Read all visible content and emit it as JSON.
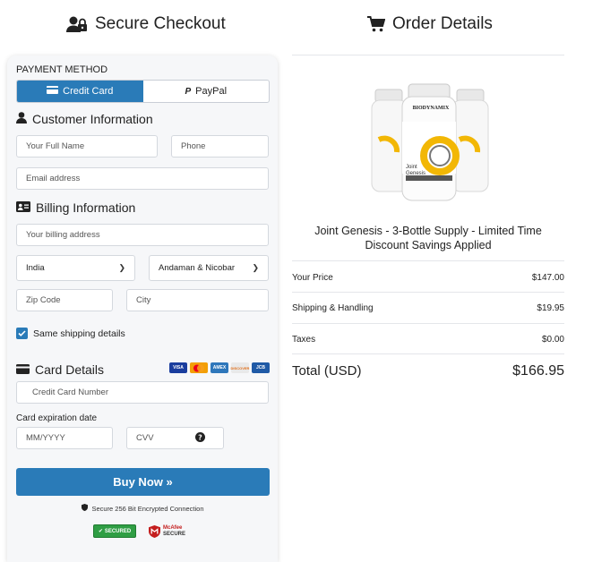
{
  "left": {
    "title": "Secure Checkout",
    "payment_method_label": "PAYMENT METHOD",
    "tabs": [
      {
        "label": "Credit Card",
        "active": true
      },
      {
        "label": "PayPal",
        "active": false
      }
    ],
    "customer_section": "Customer Information",
    "full_name_placeholder": "Your Full Name",
    "phone_placeholder": "Phone",
    "email_placeholder": "Email address",
    "billing_section": "Billing Information",
    "billing_address_placeholder": "Your billing address",
    "country_value": "India",
    "state_value": "Andaman & Nicobar",
    "zip_placeholder": "Zip Code",
    "city_placeholder": "City",
    "same_shipping_label": "Same shipping details",
    "same_shipping_checked": true,
    "card_section": "Card Details",
    "card_brands": [
      "VISA",
      "MC",
      "AMEX",
      "DISCOVER",
      "JCB"
    ],
    "card_number_placeholder": "Credit Card Number",
    "expiry_label": "Card expiration date",
    "expiry_placeholder": "MM/YYYY",
    "cvv_placeholder": "CVV",
    "buy_label": "Buy Now »",
    "secure_text": "Secure 256 Bit Encrypted Connection",
    "badge_secured": "SECURED",
    "badge_mcafee_top": "McAfee",
    "badge_mcafee_bottom": "SECURE"
  },
  "right": {
    "title": "Order Details",
    "product_brand": "BIODYNAMIX",
    "product_label": "Joint Genesis",
    "product_name": "Joint Genesis - 3-Bottle Supply - Limited Time Discount Savings Applied",
    "lines": [
      {
        "label": "Your Price",
        "value": "$147.00"
      },
      {
        "label": "Shipping & Handling",
        "value": "$19.95"
      },
      {
        "label": "Taxes",
        "value": "$0.00"
      }
    ],
    "total_label": "Total (USD)",
    "total_value": "$166.95"
  },
  "colors": {
    "accent": "#2a7bb8",
    "secured_green": "#2f9e44",
    "mcafee_red": "#c41e1e",
    "bottle_gold": "#f2b705"
  }
}
